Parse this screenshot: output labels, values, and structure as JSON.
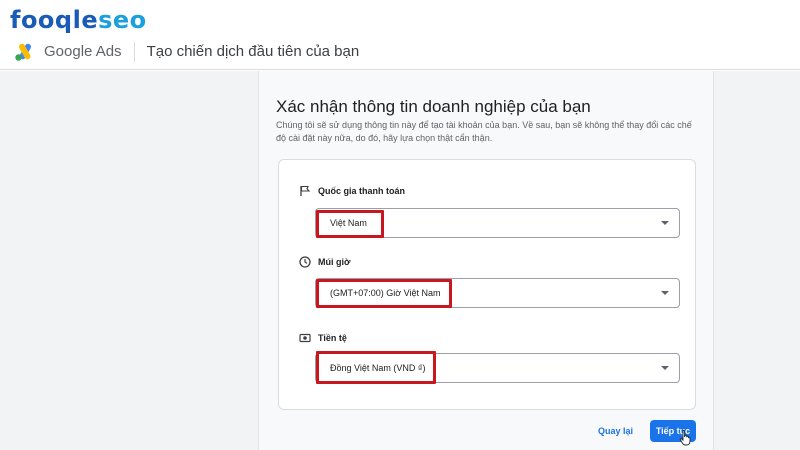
{
  "watermark": {
    "part1": "fooqle",
    "part2": "seo"
  },
  "header": {
    "product": "Google Ads",
    "title": "Tạo chiến dịch đầu tiên của bạn"
  },
  "main": {
    "heading": "Xác nhận thông tin doanh nghiệp của bạn",
    "description": "Chúng tôi sẽ sử dụng thông tin này để tạo tài khoản của bạn. Về sau, bạn sẽ không thể thay đổi các chế độ cài đặt này nữa, do đó, hãy lựa chọn thật cẩn thận."
  },
  "fields": {
    "country": {
      "label": "Quốc gia thanh toán",
      "value": "Việt Nam",
      "icon": "flag-icon"
    },
    "timezone": {
      "label": "Múi giờ",
      "value": "(GMT+07:00) Giờ Việt Nam",
      "icon": "clock-icon"
    },
    "currency": {
      "label": "Tiền tệ",
      "value": "Đồng Việt Nam (VND ₫)",
      "icon": "currency-icon"
    }
  },
  "actions": {
    "back": "Quay lại",
    "next": "Tiếp tục"
  },
  "colors": {
    "accent": "#1a73e8",
    "highlight": "#c8171e",
    "brand_dark": "#1a5bb5",
    "brand_light": "#1aa0dc"
  }
}
